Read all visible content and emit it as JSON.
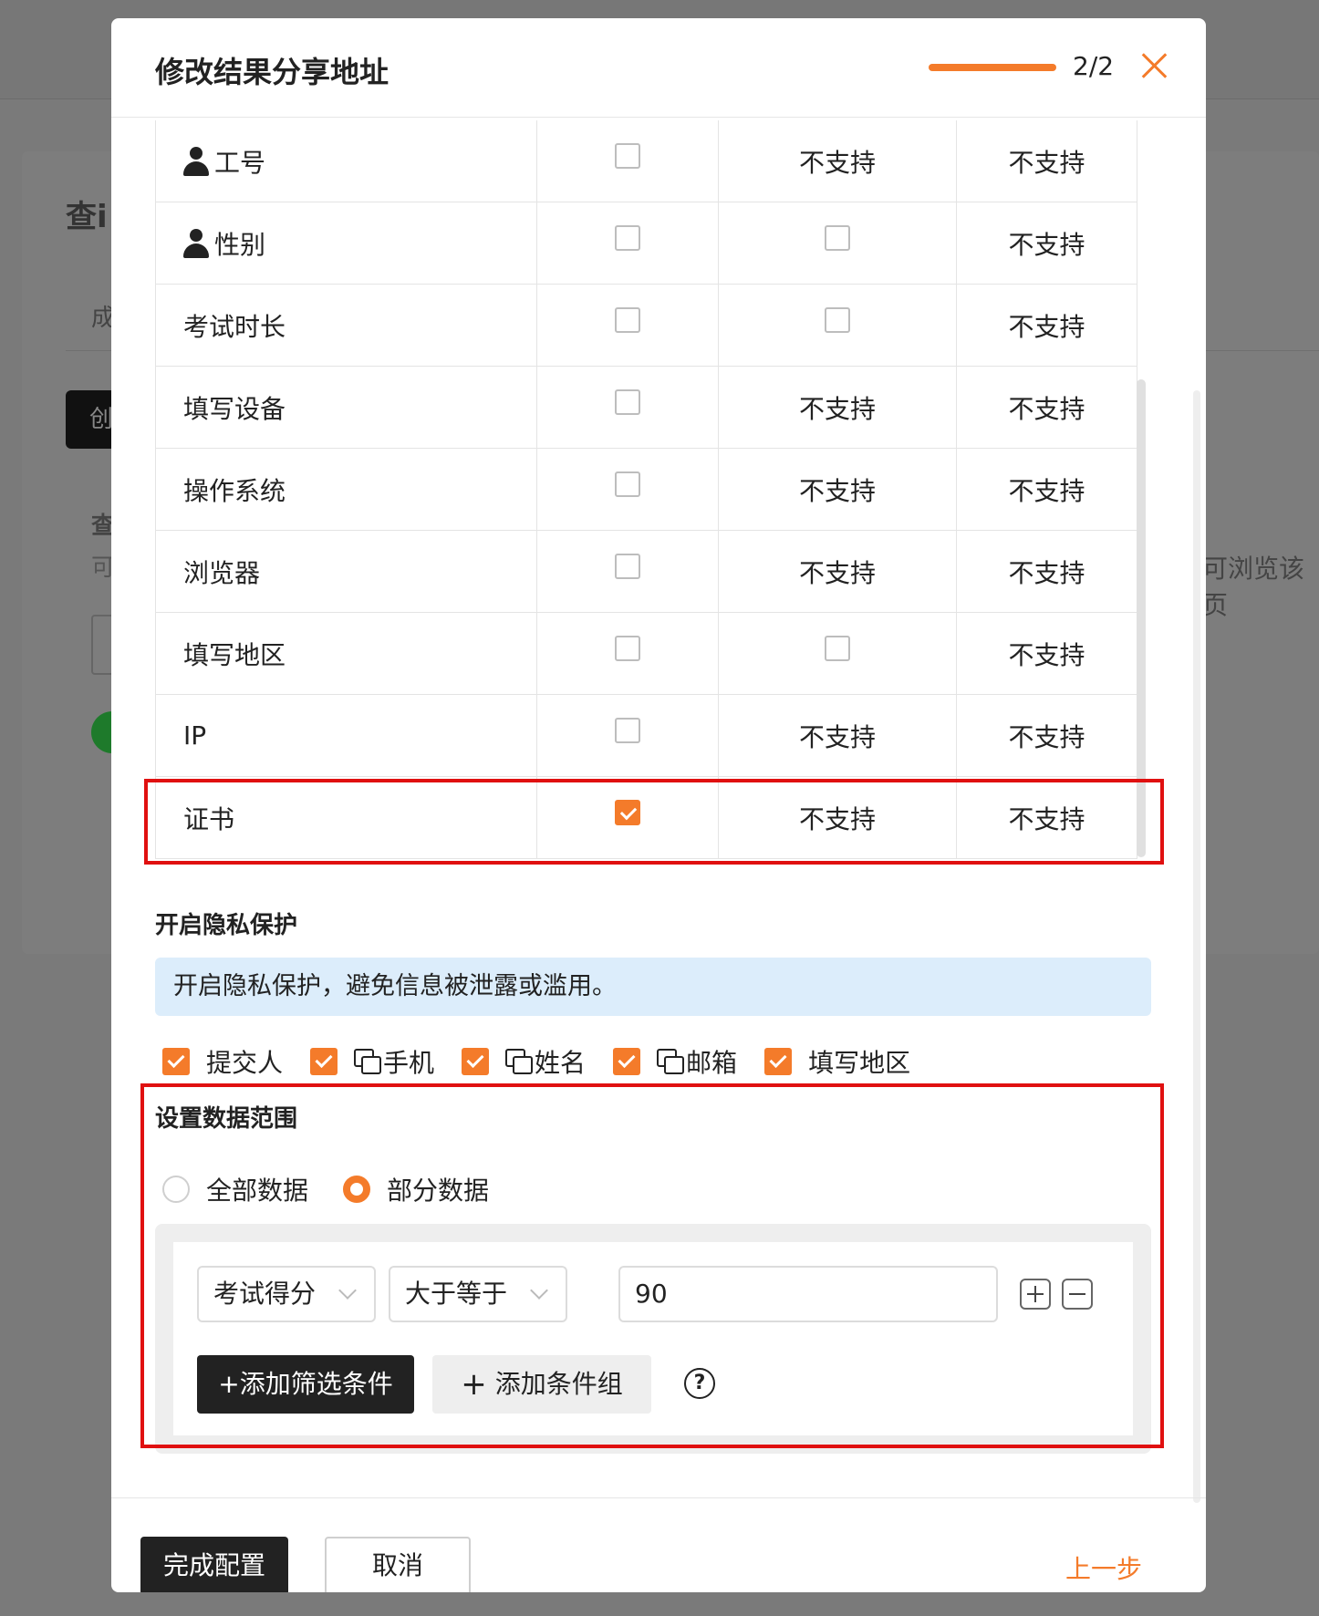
{
  "background": {
    "title_fragment": "查i",
    "tab_fragment": "成",
    "button_fragment": "创",
    "section_fragment": "查",
    "desc_fragment": "可",
    "right_text": "可浏览该页"
  },
  "modal": {
    "title": "修改结果分享地址",
    "step": "2/2",
    "progress_percent": 100,
    "accent_color": "#f47b2a"
  },
  "table": {
    "rows": [
      {
        "label": "工号",
        "user_icon": true,
        "col2": "checkbox",
        "col2_checked": false,
        "col3": "不支持",
        "col4": "不支持"
      },
      {
        "label": "性别",
        "user_icon": true,
        "col2": "checkbox",
        "col2_checked": false,
        "col3": "checkbox",
        "col4": "不支持"
      },
      {
        "label": "考试时长",
        "user_icon": false,
        "col2": "checkbox",
        "col2_checked": false,
        "col3": "checkbox",
        "col4": "不支持"
      },
      {
        "label": "填写设备",
        "user_icon": false,
        "col2": "checkbox",
        "col2_checked": false,
        "col3": "不支持",
        "col4": "不支持"
      },
      {
        "label": "操作系统",
        "user_icon": false,
        "col2": "checkbox",
        "col2_checked": false,
        "col3": "不支持",
        "col4": "不支持"
      },
      {
        "label": "浏览器",
        "user_icon": false,
        "col2": "checkbox",
        "col2_checked": false,
        "col3": "不支持",
        "col4": "不支持"
      },
      {
        "label": "填写地区",
        "user_icon": false,
        "col2": "checkbox",
        "col2_checked": false,
        "col3": "checkbox",
        "col4": "不支持"
      },
      {
        "label": "IP",
        "user_icon": false,
        "col2": "checkbox",
        "col2_checked": false,
        "col3": "不支持",
        "col4": "不支持"
      },
      {
        "label": "证书",
        "user_icon": false,
        "col2": "checkbox",
        "col2_checked": true,
        "col3": "不支持",
        "col4": "不支持"
      }
    ]
  },
  "privacy": {
    "title": "开启隐私保护",
    "info": "开启隐私保护，避免信息被泄露或滥用。",
    "options": [
      {
        "label": "提交人",
        "copy_icon": false
      },
      {
        "label": "手机",
        "copy_icon": true
      },
      {
        "label": "姓名",
        "copy_icon": true
      },
      {
        "label": "邮箱",
        "copy_icon": true
      },
      {
        "label": "填写地区",
        "copy_icon": false
      }
    ]
  },
  "data_range": {
    "title": "设置数据范围",
    "radio_all": "全部数据",
    "radio_partial": "部分数据",
    "selected": "部分数据",
    "filter": {
      "field": "考试得分",
      "operator": "大于等于",
      "value": "90"
    },
    "add_filter_label": "+添加筛选条件",
    "add_group_label": "添加条件组",
    "help_label": "?"
  },
  "footer": {
    "done_label": "完成配置",
    "cancel_label": "取消",
    "prev_label": "上一步"
  }
}
